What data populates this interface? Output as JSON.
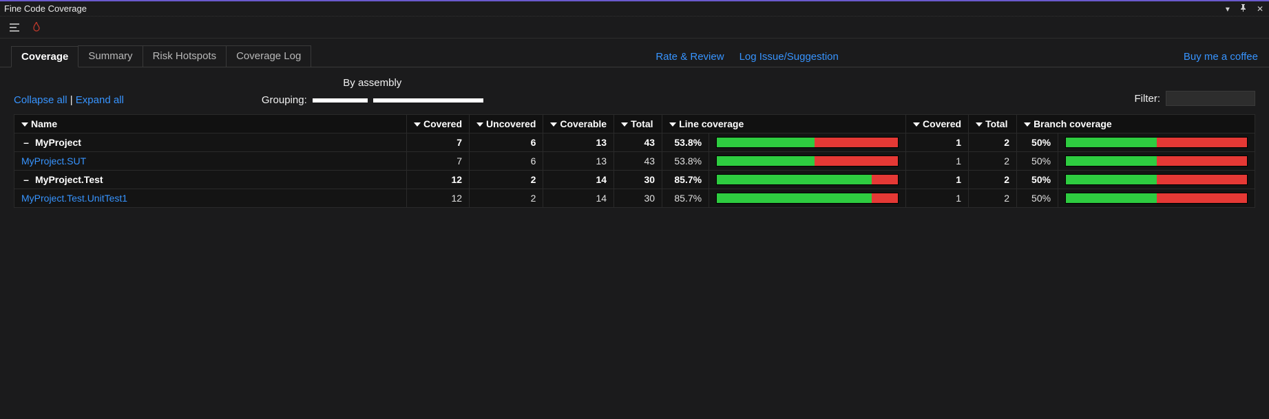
{
  "window": {
    "title": "Fine Code Coverage"
  },
  "titlebar_icons": {
    "dropdown": "▾",
    "pin": "📌",
    "close": "✕"
  },
  "tabs": [
    {
      "label": "Coverage",
      "active": true
    },
    {
      "label": "Summary",
      "active": false
    },
    {
      "label": "Risk Hotspots",
      "active": false
    },
    {
      "label": "Coverage Log",
      "active": false
    }
  ],
  "links": {
    "rate": "Rate & Review",
    "issue": "Log Issue/Suggestion",
    "coffee": "Buy me a coffee"
  },
  "controls": {
    "collapse": "Collapse all",
    "expand": "Expand all",
    "grouping_label": "Grouping:",
    "grouping_mode": "By assembly",
    "filter_label": "Filter:",
    "filter_value": ""
  },
  "columns": {
    "name": "Name",
    "covered": "Covered",
    "uncovered": "Uncovered",
    "coverable": "Coverable",
    "total": "Total",
    "line_coverage": "Line coverage",
    "b_covered": "Covered",
    "b_total": "Total",
    "branch_coverage": "Branch coverage"
  },
  "rows": [
    {
      "type": "group",
      "name": "MyProject",
      "covered": 7,
      "uncovered": 6,
      "coverable": 13,
      "total": 43,
      "line_pct": "53.8%",
      "line_bar": 53.8,
      "b_covered": 1,
      "b_total": 2,
      "b_pct": "50%",
      "b_bar": 50
    },
    {
      "type": "detail",
      "name": "MyProject.SUT",
      "covered": 7,
      "uncovered": 6,
      "coverable": 13,
      "total": 43,
      "line_pct": "53.8%",
      "line_bar": 53.8,
      "b_covered": 1,
      "b_total": 2,
      "b_pct": "50%",
      "b_bar": 50
    },
    {
      "type": "group",
      "name": "MyProject.Test",
      "covered": 12,
      "uncovered": 2,
      "coverable": 14,
      "total": 30,
      "line_pct": "85.7%",
      "line_bar": 85.7,
      "b_covered": 1,
      "b_total": 2,
      "b_pct": "50%",
      "b_bar": 50
    },
    {
      "type": "detail",
      "name": "MyProject.Test.UnitTest1",
      "covered": 12,
      "uncovered": 2,
      "coverable": 14,
      "total": 30,
      "line_pct": "85.7%",
      "line_bar": 85.7,
      "b_covered": 1,
      "b_total": 2,
      "b_pct": "50%",
      "b_bar": 50
    }
  ]
}
